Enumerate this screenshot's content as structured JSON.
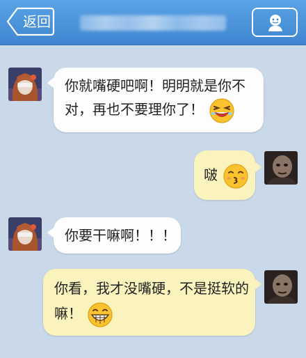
{
  "header": {
    "back_label": "返回",
    "title_state": "blurred",
    "profile_icon": "user-profile-icon",
    "colors": {
      "bar": "#4a93da",
      "text": "#ffffff"
    }
  },
  "messages": [
    {
      "side": "left",
      "line1": "你就嘴硬吧啊！明明就是你不",
      "line2": "对，再也不要理你了！",
      "emoji": "laughing-emoji-icon"
    },
    {
      "side": "right",
      "text": "啵",
      "emoji": "kissing-emoji-icon"
    },
    {
      "side": "left",
      "text": "你要干嘛啊！！！"
    },
    {
      "side": "right",
      "line1": "你看，我才没嘴硬，不是挺软的",
      "line2": "嘛！",
      "emoji": "grinning-emoji-icon"
    }
  ],
  "colors": {
    "background": "#c9d9e9",
    "bubble_in": "#fdfdfd",
    "bubble_out": "#fbf3bd"
  }
}
